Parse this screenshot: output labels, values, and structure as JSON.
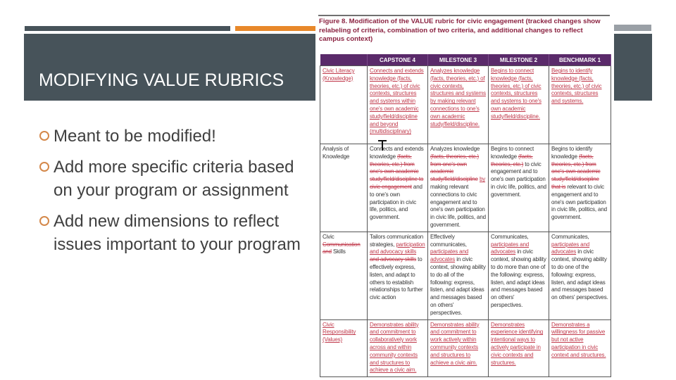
{
  "slide": {
    "title": "MODIFYING VALUE RUBRICS",
    "bullets": [
      "Meant to be modified!",
      "Add more specific criteria based on your program or assignment",
      "Add new dimensions to reflect issues important to your program"
    ]
  },
  "colors": {
    "band": "#47535a",
    "accent_orange": "#e8882a",
    "header_purple": "#5a2a6a",
    "caption_red": "#8b2341",
    "tracked_change": "#c0394b"
  },
  "figure": {
    "caption": "Figure 8. Modification of the VALUE rubric for civic engagement (tracked changes show relabeling of criteria, combination of two criteria, and additional changes to reflect campus context)",
    "columns": [
      "",
      "CAPSTONE 4",
      "MILESTONE 3",
      "MILESTONE 2",
      "BENCHMARK 1"
    ],
    "rows": [
      {
        "criterion": [
          {
            "t": "Civic Literacy (Knowledge)",
            "s": "ins"
          }
        ],
        "cells": [
          [
            {
              "t": "Connects and extends knowledge (facts, theories, etc.) of civic contexts, structures and systems within one's own academic study/field/discipline and beyond (multidisciplinary)",
              "s": "ins"
            }
          ],
          [
            {
              "t": "Analyzes knowledge (facts, theories, etc.) of civic contexts, structures and systems by making relevant connections to one's own academic study/field/discipline.",
              "s": "ins"
            }
          ],
          [
            {
              "t": "Begins to connect knowledge (facts, theories, etc.) of civic contexts, structures and systems to one's own academic study/field/discipline.",
              "s": "ins"
            }
          ],
          [
            {
              "t": "Begins to identify knowledge (facts, theories, etc.) of civic contexts, structures and systems.",
              "s": "ins"
            }
          ]
        ]
      },
      {
        "criterion": [
          {
            "t": "Analysis of Knowledge",
            "s": "n"
          }
        ],
        "cells": [
          [
            {
              "t": "Connects and extends knowledge ",
              "s": "n"
            },
            {
              "t": "(facts, theories, etc.) from one's own academic study/field/discipline to civic engagement",
              "s": "del"
            },
            {
              "t": " and to one's own participation in civic life, politics, and government.",
              "s": "n"
            }
          ],
          [
            {
              "t": "Analyzes knowledge ",
              "s": "n"
            },
            {
              "t": "(facts, theories, etc.) from one's own academic study/field/discipline",
              "s": "del"
            },
            {
              "t": " ",
              "s": "n"
            },
            {
              "t": "by",
              "s": "ins"
            },
            {
              "t": " making relevant connections to civic engagement and to one's own participation in civic life, politics, and government.",
              "s": "n"
            }
          ],
          [
            {
              "t": "Begins to connect knowledge ",
              "s": "n"
            },
            {
              "t": "(facts, theories, etc.)",
              "s": "del"
            },
            {
              "t": " to civic engagement and to one's own participation in civic life, politics, and government.",
              "s": "n"
            }
          ],
          [
            {
              "t": "Begins to identify knowledge ",
              "s": "n"
            },
            {
              "t": "(facts, theories, etc.) from one's own academic study/field/discipline that is",
              "s": "del"
            },
            {
              "t": " relevant to civic engagement and to one's own participation in civic life, politics, and government.",
              "s": "n"
            }
          ]
        ]
      },
      {
        "criterion": [
          {
            "t": "Civic ",
            "s": "n"
          },
          {
            "t": "Communication and",
            "s": "del"
          },
          {
            "t": " Skills",
            "s": "n"
          }
        ],
        "cells": [
          [
            {
              "t": "Tailors communication strategies, ",
              "s": "n"
            },
            {
              "t": "participation and advocacy skills",
              "s": "ins"
            },
            {
              "t": " ",
              "s": "n"
            },
            {
              "t": "and advocacy skills",
              "s": "del"
            },
            {
              "t": " to effectively express, listen, and adapt to others to establish relationships to further civic action",
              "s": "n"
            }
          ],
          [
            {
              "t": "Effectively communicates, ",
              "s": "n"
            },
            {
              "t": "participates and advocates",
              "s": "ins"
            },
            {
              "t": " in civic context, showing ability to do all of the following: express, listen, and adapt ideas and messages based on others' perspectives.",
              "s": "n"
            }
          ],
          [
            {
              "t": "Communicates, ",
              "s": "n"
            },
            {
              "t": "participates and advocates",
              "s": "ins"
            },
            {
              "t": " in civic context, showing ability to do more than one of the following: express, listen, and adapt ideas and messages based on others' perspectives.",
              "s": "n"
            }
          ],
          [
            {
              "t": "Communicates, ",
              "s": "n"
            },
            {
              "t": "participates and advocates",
              "s": "ins"
            },
            {
              "t": " in civic context, showing ability to do one of the following: express, listen, and adapt ideas and messages based on others' perspectives.",
              "s": "n"
            }
          ]
        ]
      },
      {
        "criterion": [
          {
            "t": "Civic Responsibility (Values)",
            "s": "ins"
          }
        ],
        "cells": [
          [
            {
              "t": "Demonstrates ability and commitment to collaboratively work across and within community contexts and structures to achieve a civic aim.",
              "s": "ins"
            }
          ],
          [
            {
              "t": "Demonstrates ability and commitment to work actively within community contexts and structures to achieve a civic aim.",
              "s": "ins"
            }
          ],
          [
            {
              "t": "Demonstrates experience identifying intentional ways to actively participate in civic contexts and structures.",
              "s": "ins"
            }
          ],
          [
            {
              "t": "Demonstrates a willingness for passive but not active participation in civic context and structures.",
              "s": "ins"
            }
          ]
        ]
      }
    ]
  }
}
